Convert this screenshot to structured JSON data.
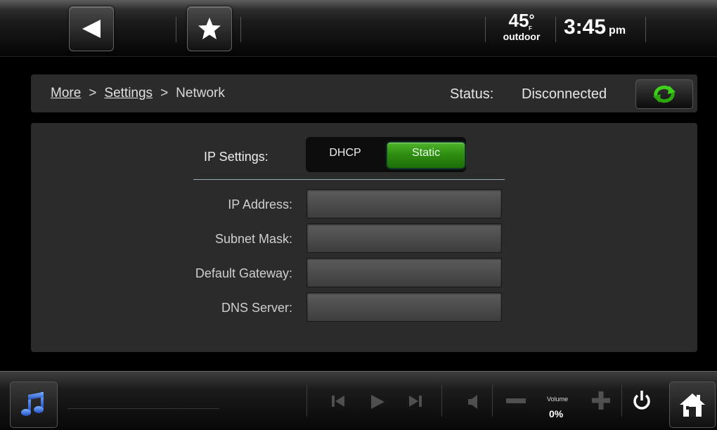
{
  "header": {
    "temperature": "45",
    "degree_symbol": "°",
    "temperature_unit": "F",
    "temperature_location": "outdoor",
    "time": "3:45",
    "ampm": "pm"
  },
  "breadcrumb": {
    "items": [
      "More",
      "Settings",
      "Network"
    ],
    "separator": ">"
  },
  "status": {
    "label": "Status:",
    "value": "Disconnected"
  },
  "ip_settings": {
    "label": "IP Settings:",
    "options": [
      "DHCP",
      "Static"
    ],
    "selected": "Static"
  },
  "fields": [
    {
      "label": "IP Address:",
      "value": ""
    },
    {
      "label": "Subnet Mask:",
      "value": ""
    },
    {
      "label": "Default Gateway:",
      "value": ""
    },
    {
      "label": "DNS Server:",
      "value": ""
    }
  ],
  "media_bar": {
    "volume_label": "Volume",
    "volume_value": "0%"
  },
  "icons": {
    "back": "back-arrow-icon",
    "favorite": "star-icon",
    "refresh": "refresh-icon",
    "music": "music-note-icon",
    "previous": "skip-previous-icon",
    "play": "play-icon",
    "next": "skip-next-icon",
    "speaker": "speaker-icon",
    "volume_down": "minus-icon",
    "volume_up": "plus-icon",
    "power": "power-icon",
    "home": "home-icon"
  },
  "colors": {
    "accent_green": "#3fa01c",
    "background": "#000000",
    "panel": "#2b2b2b"
  }
}
